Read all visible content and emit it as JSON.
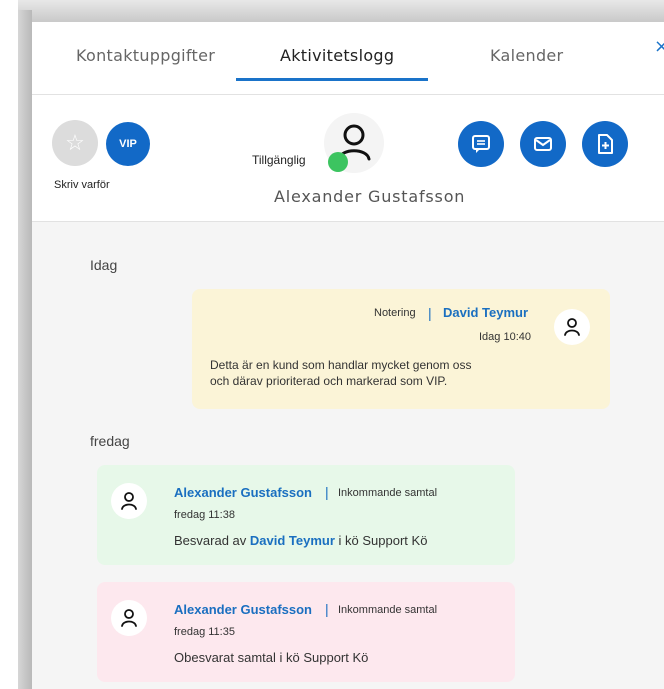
{
  "tabs": [
    {
      "label": "Kontaktuppgifter"
    },
    {
      "label": "Aktivitetslogg"
    },
    {
      "label": "Kalender"
    }
  ],
  "close_label": "×",
  "header": {
    "vip_label": "VIP",
    "skriv_label": "Skriv varför",
    "status_label": "Tillgänglig",
    "contact_name": "Alexander  Gustafsson",
    "colors": {
      "accent": "#1269c7",
      "available": "#3cc460"
    }
  },
  "activity": {
    "groups": [
      {
        "day": "Idag",
        "entries": [
          {
            "type": "Notering",
            "author": "David Teymur",
            "time": "Idag 10:40",
            "text_line1": "Detta är en kund som handlar mycket genom oss",
            "text_line2": "och därav prioriterad och markerad som VIP."
          }
        ]
      },
      {
        "day": "fredag",
        "entries": [
          {
            "author": "Alexander Gustafsson",
            "type": "Inkommande samtal",
            "time": "fredag 11:38",
            "text_prefix": "Besvarad av",
            "text_agent": "David Teymur",
            "text_suffix": "i kö Support Kö"
          },
          {
            "author": "Alexander Gustafsson",
            "type": "Inkommande samtal",
            "time": "fredag 11:35",
            "text": "Obesvarat samtal i kö Support Kö"
          }
        ]
      }
    ]
  }
}
